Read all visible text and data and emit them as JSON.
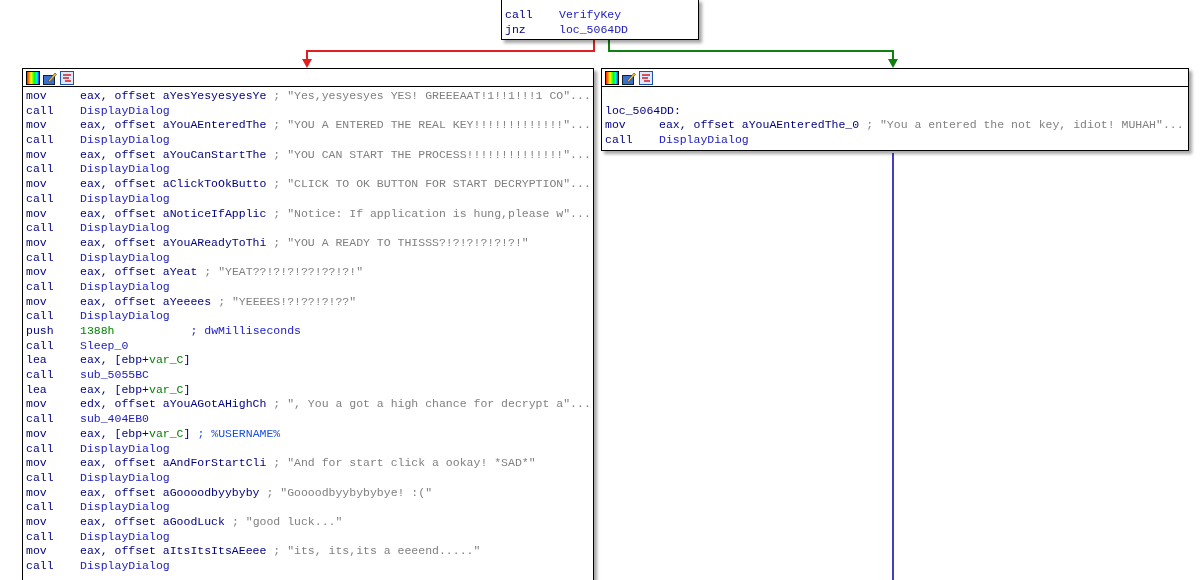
{
  "nodes": [
    {
      "kind": "top",
      "header": false,
      "lines": [
        {
          "kind": "insn",
          "mnemonic": "call",
          "operands": [
            {
              "text": "VerifyKey",
              "kind": "name"
            }
          ]
        },
        {
          "kind": "insn",
          "mnemonic": "jnz",
          "operands": [
            {
              "text": "loc_5064DD",
              "kind": "name"
            }
          ]
        }
      ]
    },
    {
      "kind": "left",
      "header": true,
      "lines": [
        {
          "kind": "insn",
          "mnemonic": "mov",
          "operands": [
            {
              "text": "eax, offset aYesYesyesyesYe",
              "kind": "plain"
            }
          ],
          "comment": {
            "text": "; \"Yes,yesyesyes YES! GREEEAAT!1!!1!!!1 CO\"...",
            "kind": "string"
          }
        },
        {
          "kind": "insn",
          "mnemonic": "call",
          "operands": [
            {
              "text": "DisplayDialog",
              "kind": "name"
            }
          ]
        },
        {
          "kind": "insn",
          "mnemonic": "mov",
          "operands": [
            {
              "text": "eax, offset aYouAEnteredThe",
              "kind": "plain"
            }
          ],
          "comment": {
            "text": "; \"YOU A ENTERED THE REAL KEY!!!!!!!!!!!!!\"...",
            "kind": "string"
          }
        },
        {
          "kind": "insn",
          "mnemonic": "call",
          "operands": [
            {
              "text": "DisplayDialog",
              "kind": "name"
            }
          ]
        },
        {
          "kind": "insn",
          "mnemonic": "mov",
          "operands": [
            {
              "text": "eax, offset aYouCanStartThe",
              "kind": "plain"
            }
          ],
          "comment": {
            "text": "; \"YOU CAN START THE PROCESS!!!!!!!!!!!!!!\"...",
            "kind": "string"
          }
        },
        {
          "kind": "insn",
          "mnemonic": "call",
          "operands": [
            {
              "text": "DisplayDialog",
              "kind": "name"
            }
          ]
        },
        {
          "kind": "insn",
          "mnemonic": "mov",
          "operands": [
            {
              "text": "eax, offset aClickToOkButto",
              "kind": "plain"
            }
          ],
          "comment": {
            "text": "; \"CLICK TO OK BUTTON FOR START DECRYPTION\"...",
            "kind": "string"
          }
        },
        {
          "kind": "insn",
          "mnemonic": "call",
          "operands": [
            {
              "text": "DisplayDialog",
              "kind": "name"
            }
          ]
        },
        {
          "kind": "insn",
          "mnemonic": "mov",
          "operands": [
            {
              "text": "eax, offset aNoticeIfApplic",
              "kind": "plain"
            }
          ],
          "comment": {
            "text": "; \"Notice: If application is hung,please w\"...",
            "kind": "string"
          }
        },
        {
          "kind": "insn",
          "mnemonic": "call",
          "operands": [
            {
              "text": "DisplayDialog",
              "kind": "name"
            }
          ]
        },
        {
          "kind": "insn",
          "mnemonic": "mov",
          "operands": [
            {
              "text": "eax, offset aYouAReadyToThi",
              "kind": "plain"
            }
          ],
          "comment": {
            "text": "; \"YOU A READY TO THISSS?!?!?!?!?!?!\"",
            "kind": "string"
          }
        },
        {
          "kind": "insn",
          "mnemonic": "call",
          "operands": [
            {
              "text": "DisplayDialog",
              "kind": "name"
            }
          ]
        },
        {
          "kind": "insn",
          "mnemonic": "mov",
          "operands": [
            {
              "text": "eax, offset aYeat",
              "kind": "plain"
            }
          ],
          "comment": {
            "text": "; \"YEAT??!?!?!??!??!?!\"",
            "kind": "string"
          }
        },
        {
          "kind": "insn",
          "mnemonic": "call",
          "operands": [
            {
              "text": "DisplayDialog",
              "kind": "name"
            }
          ]
        },
        {
          "kind": "insn",
          "mnemonic": "mov",
          "operands": [
            {
              "text": "eax, offset aYeeees",
              "kind": "plain"
            }
          ],
          "comment": {
            "text": "; \"YEEEES!?!??!?!??\"",
            "kind": "string"
          }
        },
        {
          "kind": "insn",
          "mnemonic": "call",
          "operands": [
            {
              "text": "DisplayDialog",
              "kind": "name"
            }
          ]
        },
        {
          "kind": "insn",
          "mnemonic": "push",
          "operands": [
            {
              "text": "1388h",
              "kind": "number"
            }
          ],
          "comment": {
            "text": "; dwMilliseconds",
            "kind": "auto"
          }
        },
        {
          "kind": "insn",
          "mnemonic": "call",
          "operands": [
            {
              "text": "Sleep_0",
              "kind": "name"
            }
          ]
        },
        {
          "kind": "insn",
          "mnemonic": "lea",
          "operands": [
            {
              "text": "eax, [ebp+",
              "kind": "plain"
            },
            {
              "text": "var_C",
              "kind": "var"
            },
            {
              "text": "]",
              "kind": "plain"
            }
          ]
        },
        {
          "kind": "insn",
          "mnemonic": "call",
          "operands": [
            {
              "text": "sub_5055BC",
              "kind": "name"
            }
          ]
        },
        {
          "kind": "insn",
          "mnemonic": "lea",
          "operands": [
            {
              "text": "eax, [ebp+",
              "kind": "plain"
            },
            {
              "text": "var_C",
              "kind": "var"
            },
            {
              "text": "]",
              "kind": "plain"
            }
          ]
        },
        {
          "kind": "insn",
          "mnemonic": "mov",
          "operands": [
            {
              "text": "edx, offset aYouAGotAHighCh",
              "kind": "plain"
            }
          ],
          "comment": {
            "text": "; \", You a got a high chance for decrypt a\"...",
            "kind": "string"
          }
        },
        {
          "kind": "insn",
          "mnemonic": "call",
          "operands": [
            {
              "text": "sub_404EB0",
              "kind": "name"
            }
          ]
        },
        {
          "kind": "insn",
          "mnemonic": "mov",
          "operands": [
            {
              "text": "eax, [ebp+",
              "kind": "plain"
            },
            {
              "text": "var_C",
              "kind": "var"
            },
            {
              "text": "]",
              "kind": "plain"
            }
          ],
          "comment": {
            "text": "; %USERNAME%",
            "kind": "name"
          }
        },
        {
          "kind": "insn",
          "mnemonic": "call",
          "operands": [
            {
              "text": "DisplayDialog",
              "kind": "name"
            }
          ]
        },
        {
          "kind": "insn",
          "mnemonic": "mov",
          "operands": [
            {
              "text": "eax, offset aAndForStartCli",
              "kind": "plain"
            }
          ],
          "comment": {
            "text": "; \"And for start click a ookay! *SAD*\"",
            "kind": "string"
          }
        },
        {
          "kind": "insn",
          "mnemonic": "call",
          "operands": [
            {
              "text": "DisplayDialog",
              "kind": "name"
            }
          ]
        },
        {
          "kind": "insn",
          "mnemonic": "mov",
          "operands": [
            {
              "text": "eax, offset aGoooodbyybyby",
              "kind": "plain"
            }
          ],
          "comment": {
            "text": "; \"Goooodbyybybybye! :(\"",
            "kind": "string"
          }
        },
        {
          "kind": "insn",
          "mnemonic": "call",
          "operands": [
            {
              "text": "DisplayDialog",
              "kind": "name"
            }
          ]
        },
        {
          "kind": "insn",
          "mnemonic": "mov",
          "operands": [
            {
              "text": "eax, offset aGoodLuck",
              "kind": "plain"
            }
          ],
          "comment": {
            "text": "; \"good luck...\"",
            "kind": "string"
          }
        },
        {
          "kind": "insn",
          "mnemonic": "call",
          "operands": [
            {
              "text": "DisplayDialog",
              "kind": "name"
            }
          ]
        },
        {
          "kind": "insn",
          "mnemonic": "mov",
          "operands": [
            {
              "text": "eax, offset aItsItsItsAEeee",
              "kind": "plain"
            }
          ],
          "comment": {
            "text": "; \"its, its,its a eeeend.....\"",
            "kind": "string"
          }
        },
        {
          "kind": "insn",
          "mnemonic": "call",
          "operands": [
            {
              "text": "DisplayDialog",
              "kind": "name"
            }
          ]
        }
      ]
    },
    {
      "kind": "right",
      "header": true,
      "lines": [
        {
          "kind": "blank"
        },
        {
          "kind": "label",
          "text": "loc_5064DD:"
        },
        {
          "kind": "insn",
          "mnemonic": "mov",
          "operands": [
            {
              "text": "eax, offset aYouAEnteredThe_0",
              "kind": "plain"
            }
          ],
          "comment": {
            "text": "; \"You a entered the not key, idiot! MUHAH\"...",
            "kind": "string"
          }
        },
        {
          "kind": "insn",
          "mnemonic": "call",
          "operands": [
            {
              "text": "DisplayDialog",
              "kind": "name"
            }
          ]
        }
      ]
    }
  ],
  "edges": [
    {
      "color": "#e02020"
    },
    {
      "color": "#108010"
    },
    {
      "color": "#4040c0"
    }
  ]
}
